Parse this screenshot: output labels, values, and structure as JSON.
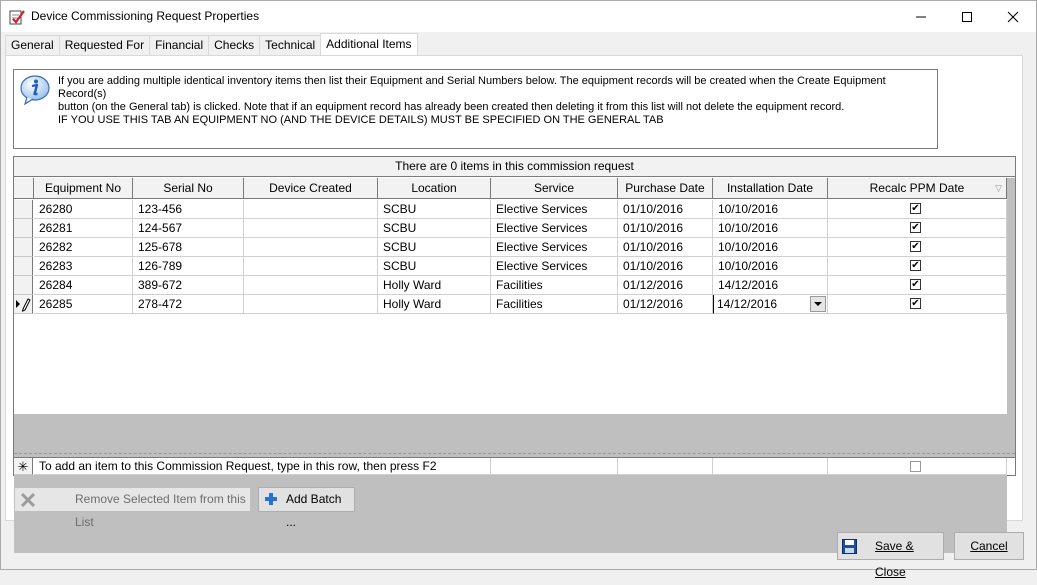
{
  "window": {
    "title": "Device Commissioning Request  Properties"
  },
  "tabs": [
    {
      "label": "General"
    },
    {
      "label": "Requested For"
    },
    {
      "label": "Financial"
    },
    {
      "label": "Checks"
    },
    {
      "label": "Technical"
    },
    {
      "label": "Additional Items",
      "active": true
    }
  ],
  "info": {
    "line1": "If you are adding multiple identical inventory items then list their Equipment and Serial Numbers below. The equipment records will be created when the Create Equipment Record(s)",
    "line2": "button (on the General tab) is clicked. Note that if an equipment record has already been created then deleting it from this list will not delete the equipment record.",
    "line3": "IF YOU USE THIS TAB AN EQUIPMENT NO (AND THE DEVICE DETAILS) MUST BE SPECIFIED ON THE GENERAL TAB"
  },
  "grid": {
    "caption": "There are 0 items in this commission request",
    "columns": [
      "Equipment No",
      "Serial No",
      "Device Created",
      "Location",
      "Service",
      "Purchase Date",
      "Installation Date",
      "Recalc PPM Date"
    ],
    "rows": [
      [
        "26280",
        "123-456",
        "",
        "SCBU",
        "Elective Services",
        "01/10/2016",
        "10/10/2016",
        true
      ],
      [
        "26281",
        "124-567",
        "",
        "SCBU",
        "Elective Services",
        "01/10/2016",
        "10/10/2016",
        true
      ],
      [
        "26282",
        "125-678",
        "",
        "SCBU",
        "Elective Services",
        "01/10/2016",
        "10/10/2016",
        true
      ],
      [
        "26283",
        "126-789",
        "",
        "SCBU",
        "Elective Services",
        "01/10/2016",
        "10/10/2016",
        true
      ],
      [
        "26284",
        "389-672",
        "",
        "Holly Ward",
        "Facilities",
        "01/12/2016",
        "14/12/2016",
        true
      ],
      [
        "26285",
        "278-472",
        "",
        "Holly Ward",
        "Facilities",
        "01/12/2016",
        "14/12/2016",
        true
      ]
    ],
    "new_row_prompt": "To add an item to this Commission Request, type in this row, then press F2"
  },
  "buttons": {
    "remove": "Remove Selected Item from this List",
    "add_batch": "Add Batch ...",
    "save_close": "Save & Close",
    "cancel": "Cancel"
  },
  "colors": {
    "accent_blue": "#1e5fbf",
    "grid_empty": "#bfbfbf"
  }
}
